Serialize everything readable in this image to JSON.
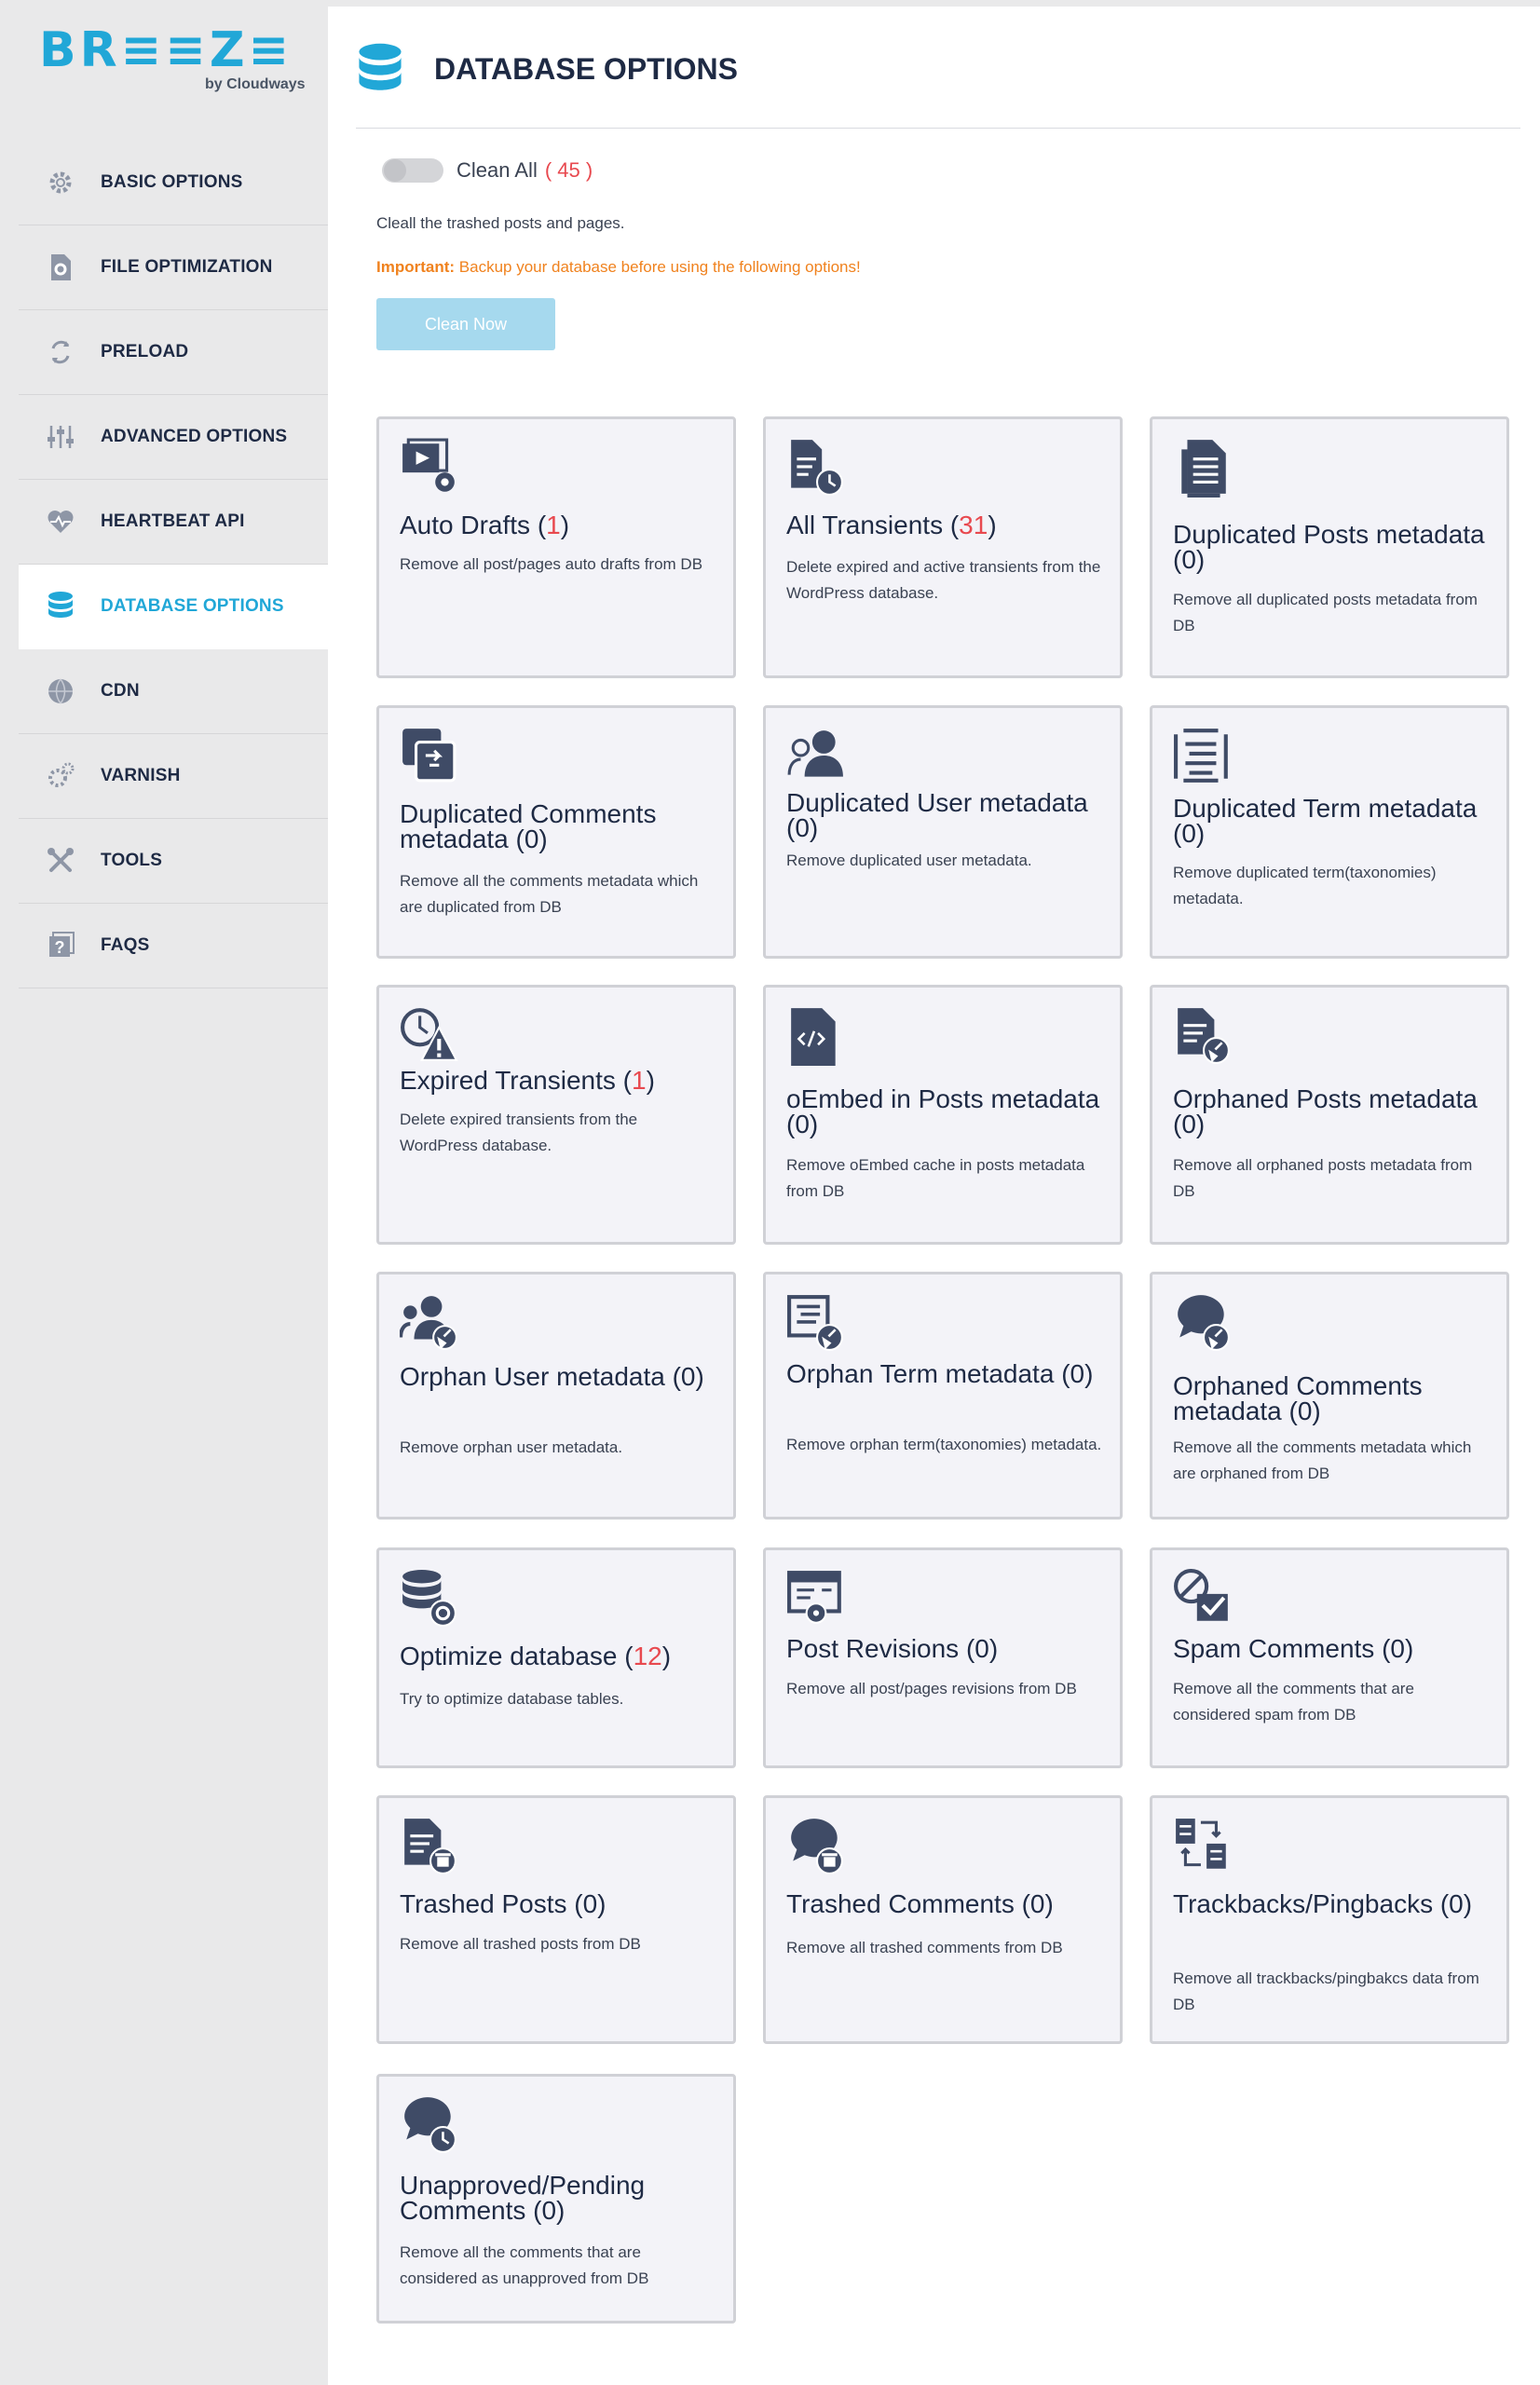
{
  "logo": {
    "word": "BR≡≡Z≡",
    "sub": "by Cloudways"
  },
  "sidebar": {
    "items": [
      {
        "label": "BASIC OPTIONS",
        "icon": "gear-icon",
        "active": false
      },
      {
        "label": "FILE OPTIMIZATION",
        "icon": "file-gear-icon",
        "active": false
      },
      {
        "label": "PRELOAD",
        "icon": "refresh-icon",
        "active": false
      },
      {
        "label": "ADVANCED OPTIONS",
        "icon": "sliders-icon",
        "active": false
      },
      {
        "label": "HEARTBEAT API",
        "icon": "heartbeat-icon",
        "active": false
      },
      {
        "label": "DATABASE OPTIONS",
        "icon": "database-icon",
        "active": true
      },
      {
        "label": "CDN",
        "icon": "globe-icon",
        "active": false
      },
      {
        "label": "VARNISH",
        "icon": "gears-icon",
        "active": false
      },
      {
        "label": "TOOLS",
        "icon": "tools-icon",
        "active": false
      },
      {
        "label": "FAQS",
        "icon": "question-icon",
        "active": false
      }
    ]
  },
  "header": {
    "title": "DATABASE OPTIONS",
    "icon": "database-icon"
  },
  "clean_all": {
    "label": "Clean All",
    "count": "( 45 )"
  },
  "note": "Cleall the trashed posts and pages.",
  "important": {
    "prefix": "Important:",
    "text": " Backup your database before using the following options!"
  },
  "clean_button": "Clean Now",
  "colors": {
    "accent": "#21a7d7",
    "count": "#e8494f",
    "warning": "#f0821e",
    "icon": "#3f4b66"
  },
  "cards": [
    {
      "title": "Auto Drafts (",
      "count": "1",
      "close": ")",
      "desc": "Remove all post/pages auto drafts from DB",
      "icon": "video-gear-icon"
    },
    {
      "title": "All Transients (",
      "count": "31",
      "close": ")",
      "desc": "Delete expired and active transients from the WordPress database.",
      "icon": "document-clock-icon"
    },
    {
      "title": "Duplicated Posts metadata (0)",
      "count": "",
      "close": "",
      "desc": "Remove all duplicated posts metadata from DB",
      "icon": "documents-icon"
    },
    {
      "title": "Duplicated Comments metadata (0)",
      "count": "",
      "close": "",
      "desc": "Remove all the comments metadata which are duplicated from DB",
      "icon": "comment-copy-icon"
    },
    {
      "title": "Duplicated User metadata (0)",
      "count": "",
      "close": "",
      "desc": "Remove duplicated user metadata.",
      "icon": "users-icon"
    },
    {
      "title": "Duplicated Term metadata (0)",
      "count": "",
      "close": "",
      "desc": "Remove duplicated term(taxonomies) metadata.",
      "icon": "term-list-icon"
    },
    {
      "title": "Expired Transients (",
      "count": "1",
      "close": ")",
      "desc": "Delete expired transients from the WordPress database.",
      "icon": "clock-warning-icon"
    },
    {
      "title": "oEmbed in Posts metadata (0)",
      "count": "",
      "close": "",
      "desc": "Remove oEmbed cache in posts metadata from DB",
      "icon": "code-file-icon"
    },
    {
      "title": "Orphaned Posts metadata (0)",
      "count": "",
      "close": "",
      "desc": "Remove all orphaned posts metadata from DB",
      "icon": "document-broom-icon"
    },
    {
      "title": "Orphan User metadata (0)",
      "count": "",
      "close": "",
      "desc": "Remove orphan user metadata.",
      "icon": "users-broom-icon"
    },
    {
      "title": "Orphan Term metadata (0)",
      "count": "",
      "close": "",
      "desc": "Remove orphan term(taxonomies) metadata.",
      "icon": "term-broom-icon"
    },
    {
      "title": "Orphaned Comments metadata (0)",
      "count": "",
      "close": "",
      "desc": "Remove all the comments metadata which are orphaned from DB",
      "icon": "comment-broom-icon"
    },
    {
      "title": "Optimize database (",
      "count": "12",
      "close": ")",
      "desc": "Try to optimize database tables.",
      "icon": "database-gear-icon"
    },
    {
      "title": "Post Revisions (0)",
      "count": "",
      "close": "",
      "desc": "Remove all post/pages revisions from DB",
      "icon": "window-revision-icon"
    },
    {
      "title": "Spam Comments (0)",
      "count": "",
      "close": "",
      "desc": "Remove all the comments that are considered spam from DB",
      "icon": "spam-check-icon"
    },
    {
      "title": "Trashed Posts (0)",
      "count": "",
      "close": "",
      "desc": "Remove all trashed posts from DB",
      "icon": "document-trash-icon"
    },
    {
      "title": "Trashed Comments (0)",
      "count": "",
      "close": "",
      "desc": "Remove all trashed comments from DB",
      "icon": "comment-trash-icon"
    },
    {
      "title": "Trackbacks/Pingbacks (0)",
      "count": "",
      "close": "",
      "desc": "Remove all trackbacks/pingbakcs data from DB",
      "icon": "swap-docs-icon"
    },
    {
      "title": "Unapproved/Pending Comments (0)",
      "count": "",
      "close": "",
      "desc": "Remove all the comments that are considered as unapproved from DB",
      "icon": "comment-clock-icon"
    }
  ]
}
